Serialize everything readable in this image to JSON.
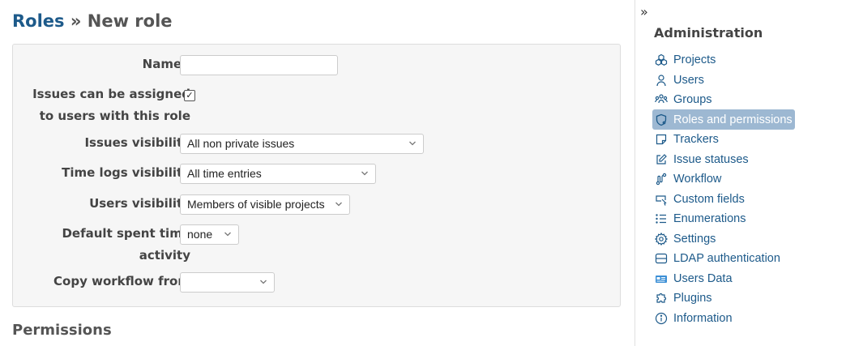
{
  "header": {
    "breadcrumb_link": "Roles",
    "separator": " » ",
    "page_title": "New role"
  },
  "form": {
    "name_label": "Name",
    "required_mark": "*",
    "name_value": "",
    "assignable_label_1": "Issues can be assigned",
    "assignable_label_2": "to users with this role",
    "assignable_checked": true,
    "issues_visibility_label": "Issues visibility",
    "issues_visibility_value": "All non private issues",
    "time_logs_label": "Time logs visibility",
    "time_logs_value": "All time entries",
    "users_visibility_label": "Users visibility",
    "users_visibility_value": "Members of visible projects",
    "spent_time_label_1": "Default spent time",
    "spent_time_label_2": "activity",
    "spent_time_value": "none",
    "copy_workflow_label": "Copy workflow from",
    "copy_workflow_value": ""
  },
  "permissions_heading": "Permissions",
  "sidebar": {
    "expand_glyph": "»",
    "title": "Administration",
    "items": [
      {
        "label": "Projects",
        "icon": "projects-icon"
      },
      {
        "label": "Users",
        "icon": "user-icon"
      },
      {
        "label": "Groups",
        "icon": "groups-icon"
      },
      {
        "label": "Roles and permissions",
        "icon": "shield-icon",
        "selected": true
      },
      {
        "label": "Trackers",
        "icon": "tracker-icon"
      },
      {
        "label": "Issue statuses",
        "icon": "edit-icon"
      },
      {
        "label": "Workflow",
        "icon": "workflow-icon"
      },
      {
        "label": "Custom fields",
        "icon": "custom-fields-icon"
      },
      {
        "label": "Enumerations",
        "icon": "list-icon"
      },
      {
        "label": "Settings",
        "icon": "gear-icon"
      },
      {
        "label": "LDAP authentication",
        "icon": "server-icon"
      },
      {
        "label": "Users Data",
        "icon": "id-card-icon"
      },
      {
        "label": "Plugins",
        "icon": "puzzle-icon"
      },
      {
        "label": "Information",
        "icon": "info-icon"
      }
    ]
  },
  "colors": {
    "link": "#1D5A8A",
    "selected_bg": "#9db8d2",
    "required": "#bb2222"
  }
}
